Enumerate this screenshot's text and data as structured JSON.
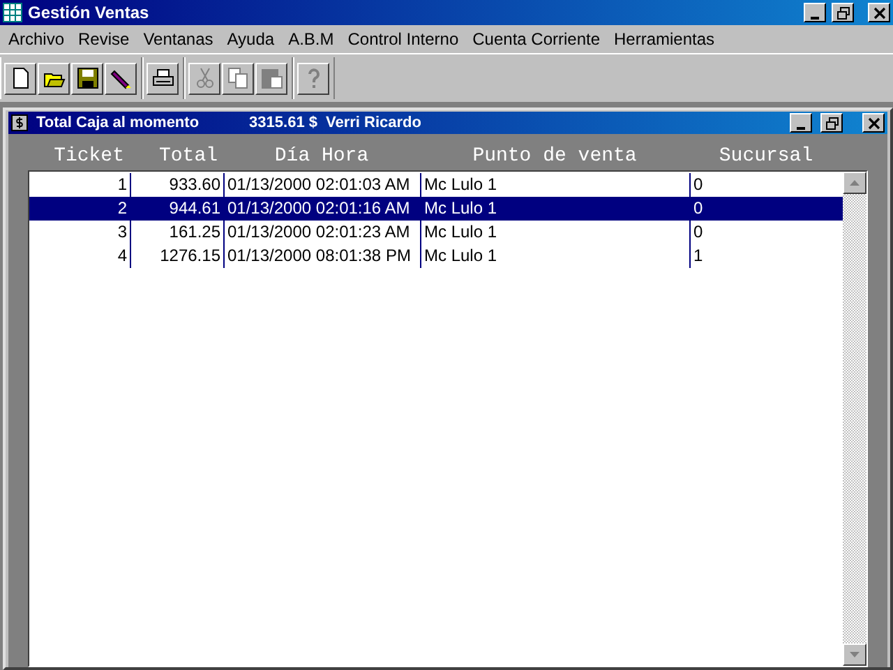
{
  "window": {
    "title": "Gestión Ventas"
  },
  "menu": [
    "Archivo",
    "Revise",
    "Ventanas",
    "Ayuda",
    "A.B.M",
    "Control Interno",
    "Cuenta Corriente",
    "Herramientas"
  ],
  "toolbar": [
    {
      "kind": "new",
      "disabled": false
    },
    {
      "kind": "open",
      "disabled": false
    },
    {
      "kind": "save",
      "disabled": false
    },
    {
      "kind": "pencil",
      "disabled": false
    },
    {
      "kind": "print",
      "disabled": false
    },
    {
      "kind": "cut",
      "disabled": true
    },
    {
      "kind": "copy",
      "disabled": true
    },
    {
      "kind": "paste",
      "disabled": true
    },
    {
      "kind": "help",
      "disabled": true
    }
  ],
  "child_window": {
    "title": "Total Caja al momento",
    "total": "3315.61 $",
    "user": "Verri Ricardo"
  },
  "table": {
    "columns": [
      "Ticket",
      "Total",
      "Día Hora",
      "Punto de venta",
      "Sucursal"
    ],
    "rows": [
      {
        "cells": [
          "1",
          "933.60",
          "01/13/2000 02:01:03 AM",
          "Mc Lulo 1",
          "0"
        ],
        "selected": false
      },
      {
        "cells": [
          "2",
          "944.61",
          "01/13/2000 02:01:16 AM",
          "Mc Lulo 1",
          "0"
        ],
        "selected": true
      },
      {
        "cells": [
          "3",
          "161.25",
          "01/13/2000 02:01:23 AM",
          "Mc Lulo 1",
          "0"
        ],
        "selected": false
      },
      {
        "cells": [
          "4",
          "1276.15",
          "01/13/2000 08:01:38 PM",
          "Mc Lulo 1",
          "1"
        ],
        "selected": false
      }
    ]
  }
}
